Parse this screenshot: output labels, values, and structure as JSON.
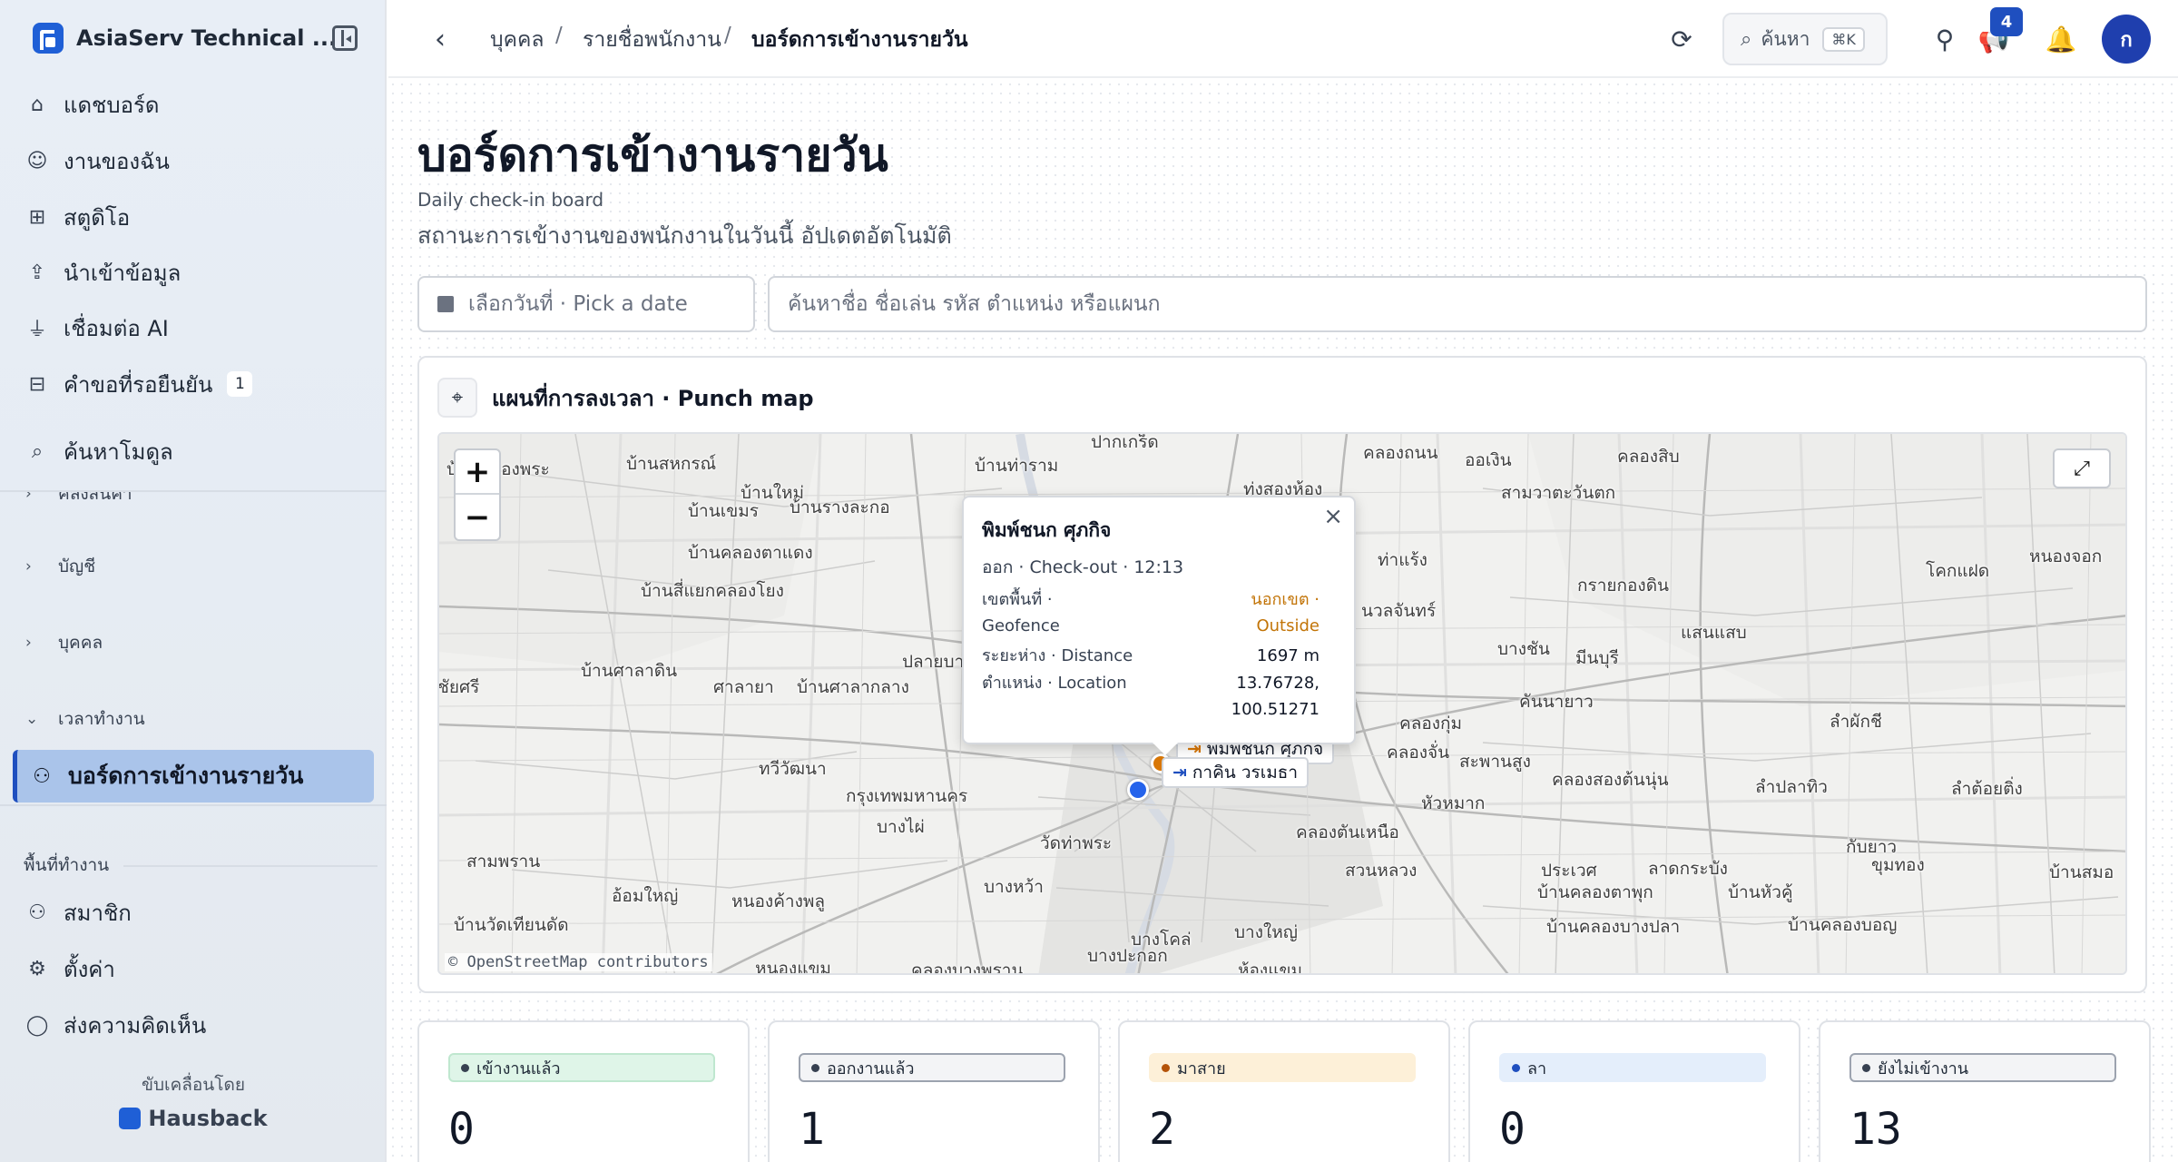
{
  "app": {
    "name": "AsiaServ Technical ..."
  },
  "sidebar": {
    "nav": [
      {
        "label": "แดชบอร์ด",
        "icon": "home-icon"
      },
      {
        "label": "งานของฉัน",
        "icon": "user-circle-icon"
      },
      {
        "label": "สตูดิโอ",
        "icon": "grid-icon"
      },
      {
        "label": "นำเข้าข้อมูล",
        "icon": "upload-icon"
      },
      {
        "label": "เชื่อมต่อ AI",
        "icon": "plug-icon"
      },
      {
        "label": "คำขอที่รอยืนยัน",
        "icon": "inbox-icon",
        "count": "1"
      }
    ],
    "module_search": "ค้นหาโมดูล",
    "sections": [
      {
        "label": "คลังสินค้า"
      },
      {
        "label": "บัญชี"
      },
      {
        "label": "บุคคล"
      },
      {
        "label": "เวลาทำงาน"
      }
    ],
    "active_item": "บอร์ดการเข้างานรายวัน",
    "workspace_label": "พื้นที่ทำงาน",
    "workspace_items": [
      {
        "label": "สมาชิก",
        "icon": "users-icon"
      },
      {
        "label": "ตั้งค่า",
        "icon": "gear-icon"
      },
      {
        "label": "ส่งความคิดเห็น",
        "icon": "chat-icon"
      }
    ],
    "powered_by": "ขับเคลื่อนโดย",
    "powered_brand": "Hausback"
  },
  "topbar": {
    "breadcrumbs": [
      "บุคคล",
      "รายชื่อพนักงาน",
      "บอร์ดการเข้างานรายวัน"
    ],
    "search_label": "ค้นหา",
    "search_shortcut": "⌘K",
    "notification_count": "4",
    "avatar_initial": "ก"
  },
  "page": {
    "title": "บอร์ดการเข้างานรายวัน",
    "subtitle_en": "Daily check-in board",
    "subtitle_th": "สถานะการเข้างานของพนักงานในวันนี้ อัปเดตอัตโนมัติ",
    "date_placeholder": "เลือกวันที่ · Pick a date",
    "search_placeholder": "ค้นหาชื่อ ชื่อเล่น รหัส ตำแหน่ง หรือแผนก"
  },
  "map": {
    "title": "แผนที่การลงเวลา · Punch map",
    "attribution": "© OpenStreetMap contributors",
    "zoom_in": "+",
    "zoom_out": "−",
    "labels": [
      "บ้านคลองพระ",
      "บ้านสหกรณ์",
      "ปากเกร็ด",
      "คลองถนน",
      "ออเงิน",
      "คลองสิบ",
      "บ้านท่าราม",
      "บ้านใหม่",
      "บ้านรางละกอ",
      "บ้านเขมร",
      "สามวาตะวันตก",
      "บ้านคลองตาแดง",
      "ทุ่งสองห้อง",
      "บ้านสี่แยกคลองโยง",
      "ท่าแร้ง",
      "หนองจอก",
      "โคกแฝด",
      "กรายกองดิน",
      "นวลจันทร์",
      "แสนแสบ",
      "บางชัน",
      "มีนบุรี",
      "บ้านศาลาดิน",
      "ศาลายา",
      "บ้านศาลากลาง",
      "ปลายบาง",
      "ชัยศรี",
      "คันนายาว",
      "ลำผักชี",
      "คลองกุ่ม",
      "คลองจั่น",
      "สะพานสูง",
      "ทวีวัฒนา",
      "กรุงเทพมหานคร",
      "คลองสองต้นนุ่น",
      "ลำปลาทิว",
      "ลำต้อยติ่ง",
      "หัวหมาก",
      "บางไผ่",
      "วัดท่าพระ",
      "สามพราน",
      "อ้อมใหญ่",
      "บางหว้า",
      "คลองตันเหนือ",
      "สวนหลวง",
      "ประเวศ",
      "ลาดกระบัง",
      "กับยาว",
      "ขุมทอง",
      "บ้านสมอ",
      "หนองค้างพลู",
      "หนองแขม",
      "บ้านวัดเทียนดัด",
      "บางโคล่",
      "บางใหญ่",
      "บ้านหัวคู้",
      "บ้านคลองตาพุก",
      "บ้านคลองบางปลา",
      "บ้านคลองบอญ",
      "ห้องแขม",
      "คลองบางพราน",
      "บางปะกอก"
    ],
    "popup": {
      "name": "พิมพ์ชนก ศุภกิจ",
      "subtitle": "ออก · Check-out · 12:13",
      "rows": [
        {
          "key": "เขตพื้นที่ · Geofence",
          "value": "นอกเขต · Outside",
          "status": "warning"
        },
        {
          "key": "ระยะห่าง · Distance",
          "value": "1697 m"
        },
        {
          "key": "ตำแหน่ง · Location",
          "value": "13.76728, 100.51271"
        }
      ]
    },
    "markers": [
      {
        "name": "พิมพ์ชนก ศุภกิจ",
        "type": "check-out",
        "color": "#d97706"
      },
      {
        "name": "กาคิน วรเมธา",
        "type": "check-in",
        "color": "#2563eb"
      }
    ]
  },
  "stats": [
    {
      "label": "เข้างานแล้ว",
      "value": "0",
      "bg": "#dff5e8",
      "dot": "#374151",
      "border": "#bfe7cf"
    },
    {
      "label": "ออกงานแล้ว",
      "value": "1",
      "bg": "#f3f4f6",
      "dot": "#374151",
      "border": "#9ca3af"
    },
    {
      "label": "มาสาย",
      "value": "2",
      "bg": "#fdf0d8",
      "dot": "#b45309",
      "border": "#fdf0d8"
    },
    {
      "label": "ลา",
      "value": "0",
      "bg": "#e4eefb",
      "dot": "#1f4fbf",
      "border": "#e4eefb"
    },
    {
      "label": "ยังไม่เข้างาน",
      "value": "13",
      "bg": "#f3f4f6",
      "dot": "#374151",
      "border": "#9ca3af"
    }
  ],
  "colors": {
    "accent": "#1f4fbf",
    "warning": "#c27407",
    "active_nav_bg": "#aac4ea"
  }
}
